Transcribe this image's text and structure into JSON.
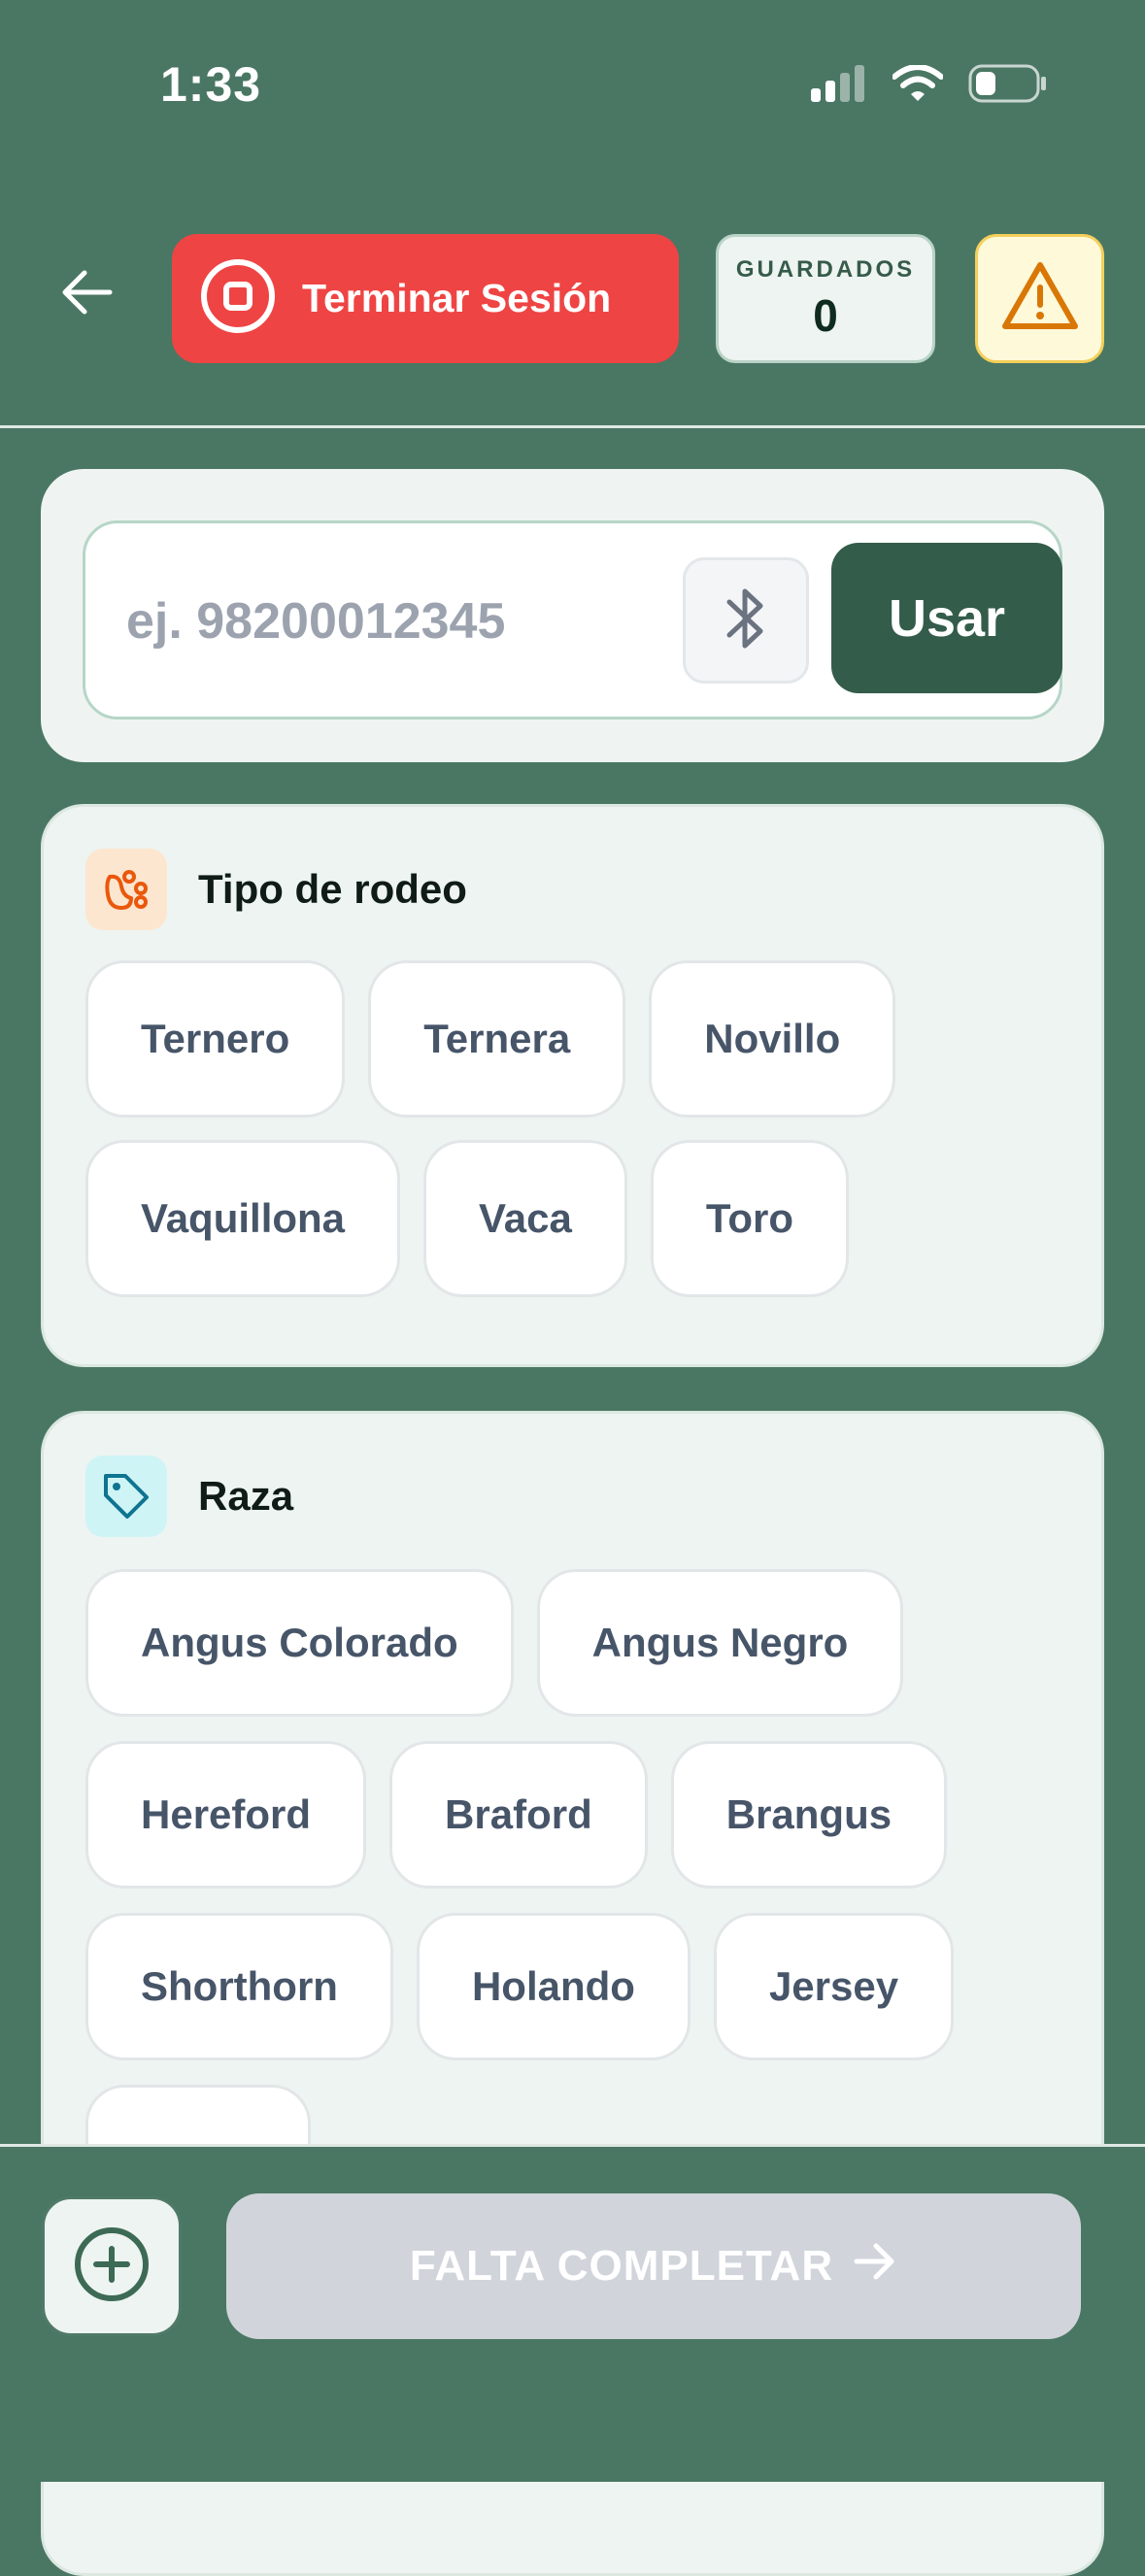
{
  "status_bar": {
    "time": "1:33",
    "icons": [
      "cellular-signal-icon",
      "wifi-icon",
      "battery-icon"
    ]
  },
  "header": {
    "back_icon": "arrow-left-icon",
    "end_session_label": "Terminar Sesión",
    "end_session_icon": "stop-circle-icon",
    "saved_caption": "GUARDADOS",
    "saved_count": "0",
    "warning_icon": "warning-triangle-icon"
  },
  "search": {
    "placeholder": "ej. 98200012345",
    "value": "",
    "bluetooth_icon": "bluetooth-icon",
    "use_label": "Usar"
  },
  "tipo_rodeo": {
    "title": "Tipo de rodeo",
    "icon": "paw-icon",
    "options": [
      "Ternero",
      "Ternera",
      "Novillo",
      "Vaquillona",
      "Vaca",
      "Toro"
    ]
  },
  "raza": {
    "title": "Raza",
    "icon": "tag-icon",
    "options": [
      "Angus Colorado",
      "Angus Negro",
      "Hereford",
      "Braford",
      "Brangus",
      "Shorthorn",
      "Holando",
      "Jersey",
      ""
    ]
  },
  "footer": {
    "add_icon": "plus-circle-icon",
    "next_label": "FALTA COMPLETAR",
    "next_icon": "arrow-right-icon"
  },
  "colors": {
    "background": "#4a7763",
    "danger": "#ef4444",
    "primary_dark": "#345c4a",
    "card": "#eef4f1",
    "warning_bg": "#fef9d9",
    "disabled": "#d1d5db"
  }
}
